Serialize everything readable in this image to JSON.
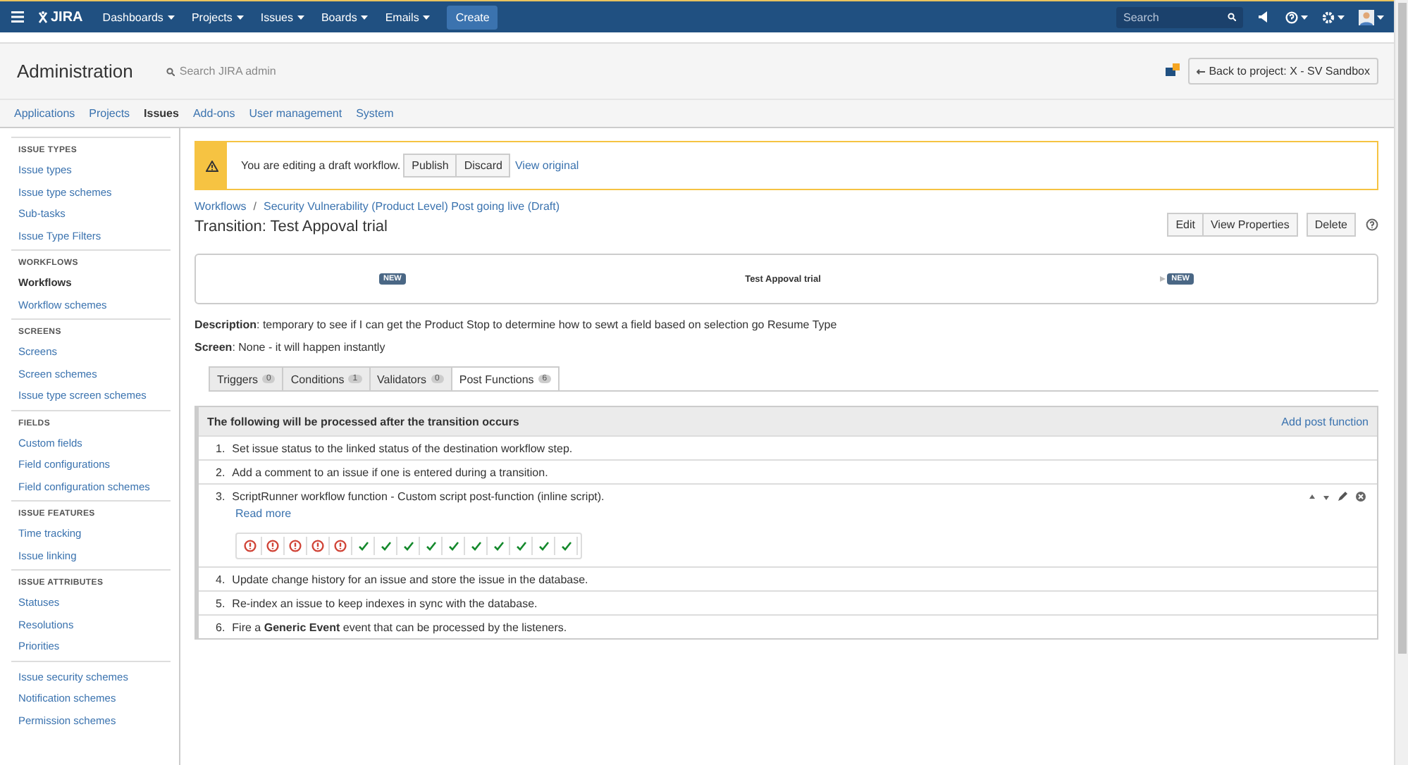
{
  "top_nav": {
    "logo": "JIRA",
    "menus": [
      {
        "label": "Dashboards"
      },
      {
        "label": "Projects"
      },
      {
        "label": "Issues"
      },
      {
        "label": "Boards"
      },
      {
        "label": "Emails"
      }
    ],
    "create": "Create",
    "search": {
      "placeholder": "Search"
    }
  },
  "header": {
    "title": "Administration",
    "search": {
      "placeholder": "Search JIRA admin"
    },
    "back_button": "Back to project: X - SV Sandbox"
  },
  "admin_tabs": [
    {
      "label": "Applications",
      "selected": false
    },
    {
      "label": "Projects",
      "selected": false
    },
    {
      "label": "Issues",
      "selected": true
    },
    {
      "label": "Add-ons",
      "selected": false
    },
    {
      "label": "User management",
      "selected": false
    },
    {
      "label": "System",
      "selected": false
    }
  ],
  "sidebar": [
    {
      "heading": "ISSUE TYPES",
      "items": [
        {
          "label": "Issue types",
          "selected": false
        },
        {
          "label": "Issue type schemes",
          "selected": false
        },
        {
          "label": "Sub-tasks",
          "selected": false
        },
        {
          "label": "Issue Type Filters",
          "selected": false
        }
      ]
    },
    {
      "heading": "WORKFLOWS",
      "items": [
        {
          "label": "Workflows",
          "selected": true
        },
        {
          "label": "Workflow schemes",
          "selected": false
        }
      ]
    },
    {
      "heading": "SCREENS",
      "items": [
        {
          "label": "Screens",
          "selected": false
        },
        {
          "label": "Screen schemes",
          "selected": false
        },
        {
          "label": "Issue type screen schemes",
          "selected": false
        }
      ]
    },
    {
      "heading": "FIELDS",
      "items": [
        {
          "label": "Custom fields",
          "selected": false
        },
        {
          "label": "Field configurations",
          "selected": false
        },
        {
          "label": "Field configuration schemes",
          "selected": false
        }
      ]
    },
    {
      "heading": "ISSUE FEATURES",
      "items": [
        {
          "label": "Time tracking",
          "selected": false
        },
        {
          "label": "Issue linking",
          "selected": false
        }
      ]
    },
    {
      "heading": "ISSUE ATTRIBUTES",
      "items": [
        {
          "label": "Statuses",
          "selected": false
        },
        {
          "label": "Resolutions",
          "selected": false
        },
        {
          "label": "Priorities",
          "selected": false
        }
      ]
    },
    {
      "items": [
        {
          "label": "Issue security schemes",
          "selected": false
        },
        {
          "label": "Notification schemes",
          "selected": false
        },
        {
          "label": "Permission schemes",
          "selected": false
        }
      ]
    }
  ],
  "banner": {
    "message": "You are editing a draft workflow.",
    "buttons": [
      "Publish",
      "Discard"
    ],
    "link": "View original"
  },
  "breadcrumb": [
    "Workflows",
    "Security Vulnerability (Product Level) Post going live (Draft)"
  ],
  "breadcrumb_separator": "/",
  "title": "Transition: Test Appoval trial",
  "actions": [
    [
      "Edit",
      "View Properties"
    ],
    [
      "Delete"
    ]
  ],
  "diagram": {
    "from": "NEW",
    "transition": "Test Appoval trial",
    "to": "NEW"
  },
  "description": "**Description**: temporary to see if I can get the Product Stop to determine how to sewt a field based on selection go Resume Type",
  "screen": "**Screen**: None - it will happen instantly",
  "tabs": [
    {
      "label": "Triggers",
      "count": "0",
      "selected": false
    },
    {
      "label": "Conditions",
      "count": "1",
      "selected": false
    },
    {
      "label": "Validators",
      "count": "0",
      "selected": false
    },
    {
      "label": "Post Functions",
      "count": "6",
      "selected": true
    }
  ],
  "post_functions": {
    "heading": "The following will be processed after the transition occurs",
    "add_link": "Add post function",
    "items": [
      {
        "number": "1.",
        "text": "Set issue status to the linked status of the destination workflow step."
      },
      {
        "number": "2.",
        "text": "Add a comment to an issue if one is entered during a transition."
      },
      {
        "number": "3.",
        "text": "ScriptRunner workflow function - Custom script post-function (inline script).",
        "read_more": "Read more",
        "editable": true,
        "results": [
          {
            "kind": "error"
          },
          {
            "kind": "error"
          },
          {
            "kind": "error"
          },
          {
            "kind": "error"
          },
          {
            "kind": "error"
          },
          {
            "kind": "ok"
          },
          {
            "kind": "ok"
          },
          {
            "kind": "ok"
          },
          {
            "kind": "ok"
          },
          {
            "kind": "ok"
          },
          {
            "kind": "ok"
          },
          {
            "kind": "ok"
          },
          {
            "kind": "ok"
          },
          {
            "kind": "ok"
          },
          {
            "kind": "ok"
          }
        ]
      },
      {
        "number": "4.",
        "text": "Update change history for an issue and store the issue in the database."
      },
      {
        "number": "5.",
        "text": "Re-index an issue to keep indexes in sync with the database."
      },
      {
        "number": "6.",
        "text": "Fire a **Generic Event** event that can be processed by the listeners."
      }
    ]
  }
}
